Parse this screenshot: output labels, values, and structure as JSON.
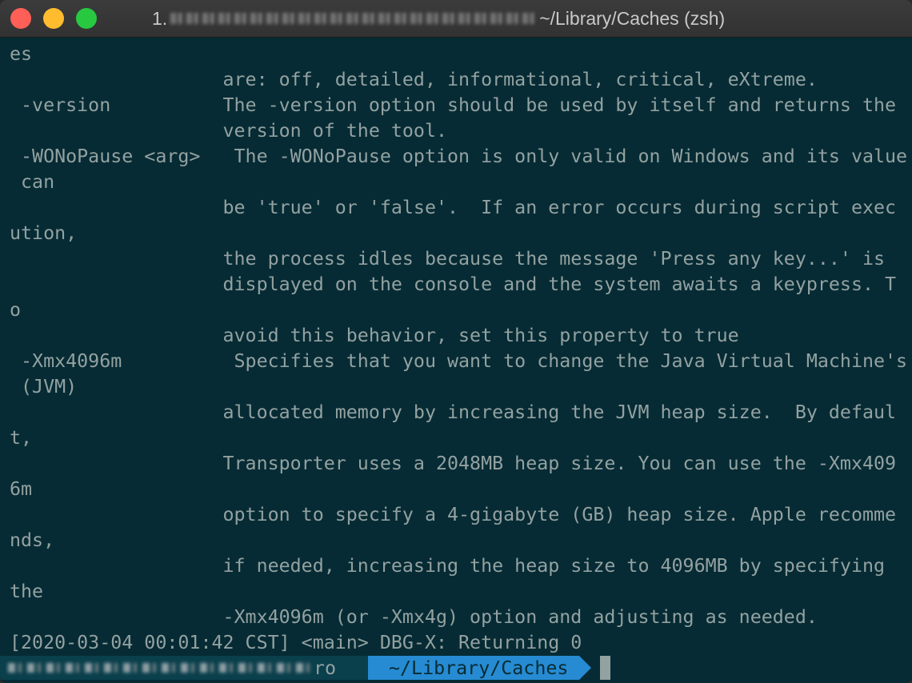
{
  "window": {
    "title_prefix": "1.",
    "title_suffix": "~/Library/Caches (zsh)"
  },
  "terminal": {
    "lines": [
      "es",
      "                   are: off, detailed, informational, critical, eXtreme.",
      " -version          The -version option should be used by itself and returns the",
      "                   version of the tool.",
      " -WONoPause <arg>   The -WONoPause option is only valid on Windows and its value",
      " can",
      "                   be 'true' or 'false'.  If an error occurs during script exec",
      "ution,",
      "                   the process idles because the message 'Press any key...' is",
      "                   displayed on the console and the system awaits a keypress. T",
      "o",
      "                   avoid this behavior, set this property to true",
      " -Xmx4096m          Specifies that you want to change the Java Virtual Machine's",
      " (JVM)",
      "                   allocated memory by increasing the JVM heap size.  By defaul",
      "t,",
      "                   Transporter uses a 2048MB heap size. You can use the -Xmx409",
      "6m",
      "                   option to specify a 4-gigabyte (GB) heap size. Apple recomme",
      "nds,",
      "                   if needed, increasing the heap size to 4096MB by specifying",
      "the",
      "                   -Xmx4096m (or -Xmx4g) option and adjusting as needed.",
      "[2020-03-04 00:01:42 CST] <main> DBG-X: Returning 0"
    ]
  },
  "prompt": {
    "user_tail": "ro",
    "path": "~/Library/Caches"
  },
  "colors": {
    "background": "#062b34",
    "text": "#93a1a1",
    "path_segment": "#268bd2",
    "user_segment": "#0a3f4c"
  }
}
